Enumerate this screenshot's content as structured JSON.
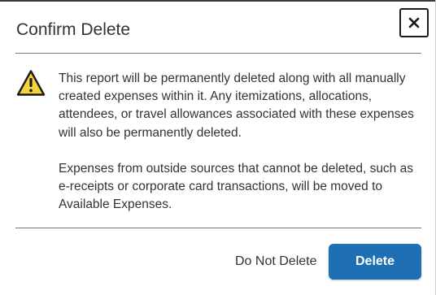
{
  "dialog": {
    "title": "Confirm Delete",
    "close_icon": "close-icon",
    "warning_icon": "warning-triangle-icon",
    "paragraphs": [
      "This report will be permanently deleted along with all manually created expenses within it. Any itemizations, allocations, attendees, or travel allowances associated with these expenses will also be permanently deleted.",
      "Expenses from outside sources that cannot be deleted, such as e-receipts or corporate card transactions, will be moved to Available Expenses."
    ],
    "cancel_label": "Do Not Delete",
    "delete_label": "Delete"
  },
  "colors": {
    "primary_button": "#1f6fb5",
    "warning_fill": "#f5d33a",
    "text": "#333333"
  }
}
